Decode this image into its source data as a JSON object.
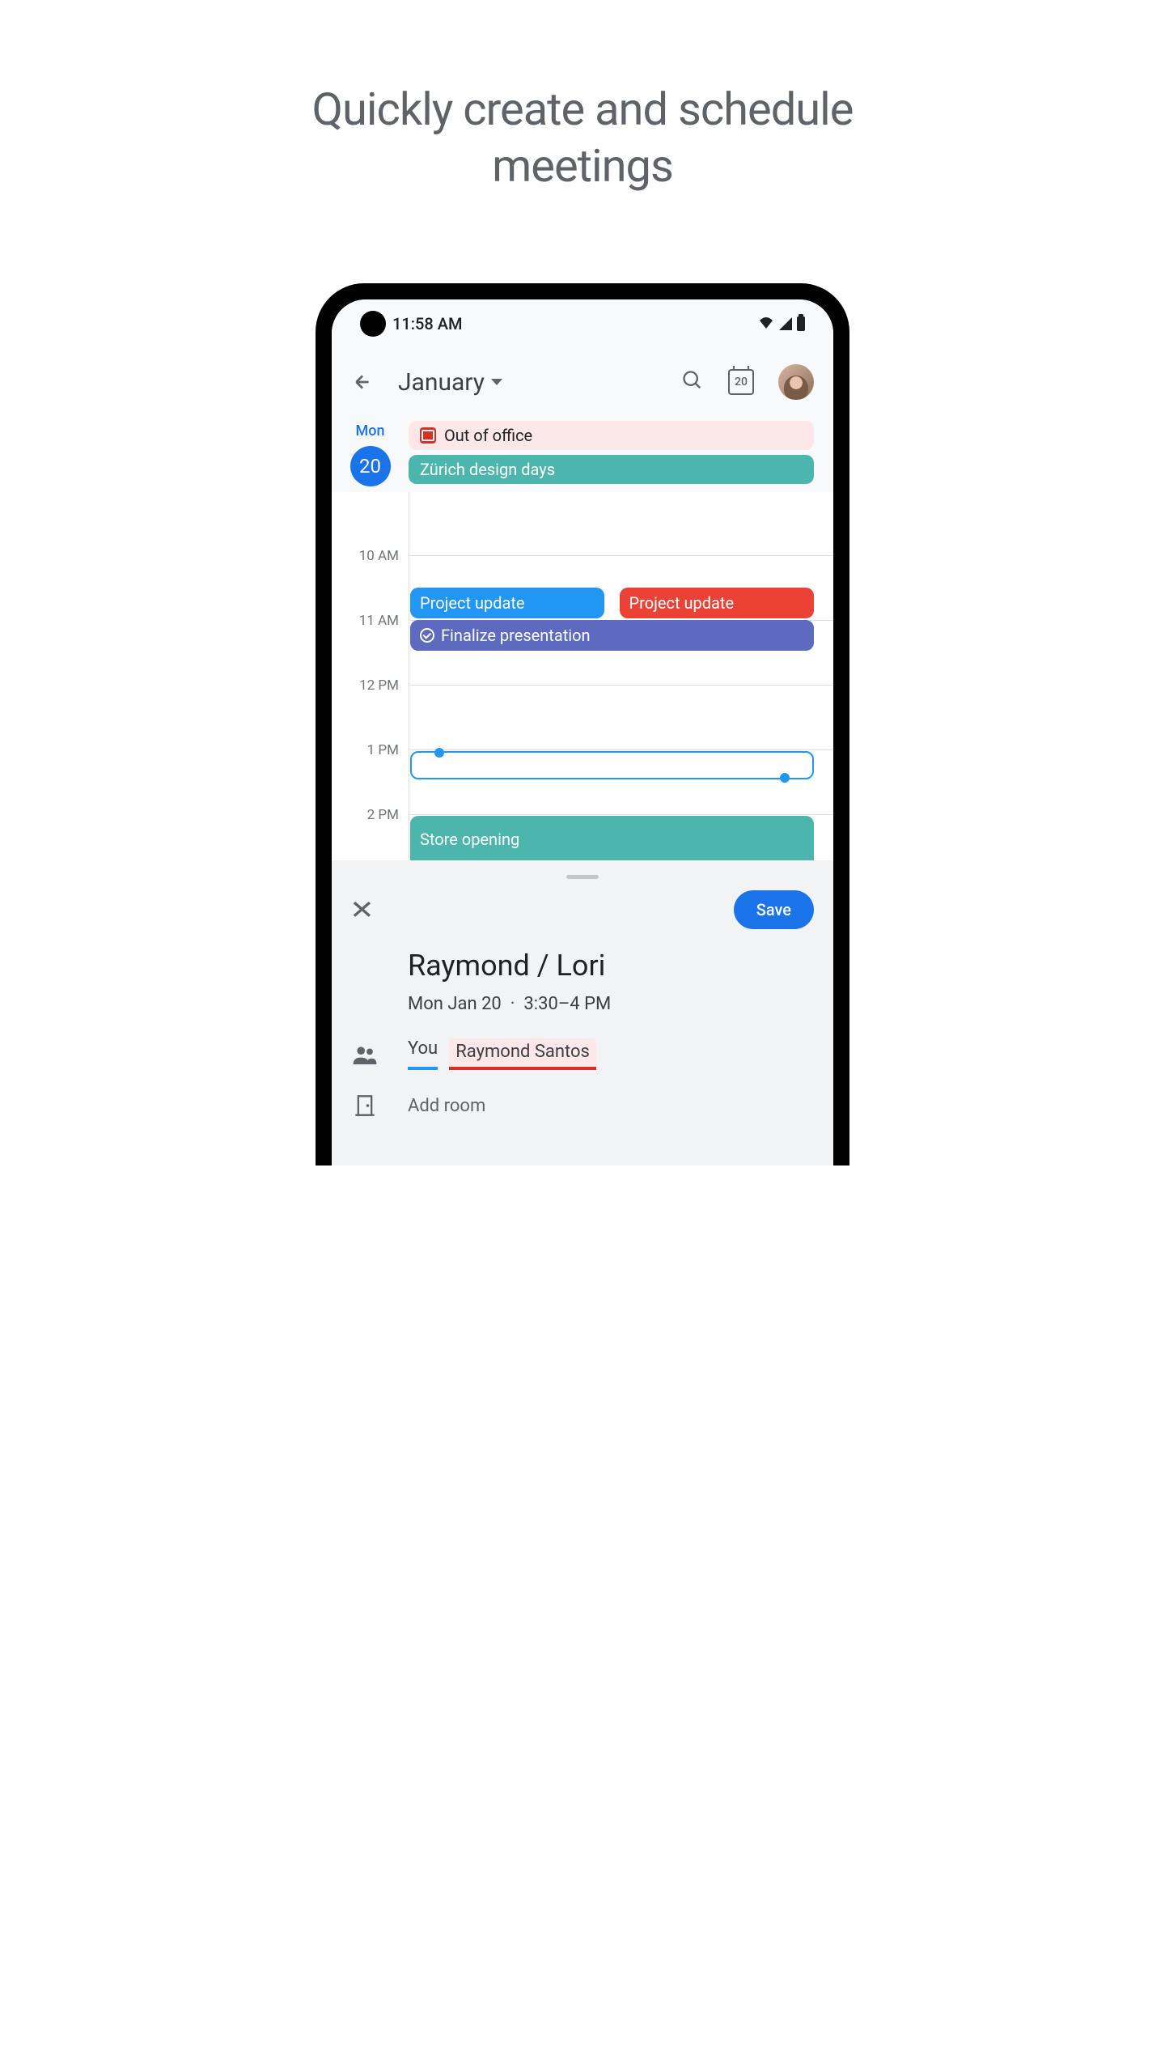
{
  "marketing": {
    "headline": "Quickly create and schedule meetings"
  },
  "statusBar": {
    "time": "11:58 AM"
  },
  "header": {
    "month": "January",
    "todayDate": "20"
  },
  "day": {
    "label": "Mon",
    "number": "20"
  },
  "alldayEvents": [
    {
      "label": "Out of office",
      "type": "ooo"
    },
    {
      "label": "Zürich design days",
      "type": "green"
    }
  ],
  "timeSlots": [
    "",
    "10 AM",
    "11 AM",
    "12 PM",
    "1 PM",
    "2 PM"
  ],
  "timedEvents": {
    "projectUpdate1": "Project update",
    "projectUpdate2": "Project update",
    "finalize": "Finalize presentation",
    "storeOpening": "Store opening"
  },
  "sheet": {
    "saveLabel": "Save",
    "title": "Raymond / Lori",
    "date": "Mon Jan 20",
    "separator": "·",
    "time": "3:30–4 PM",
    "chipYou": "You",
    "chipRaymond": "Raymond Santos",
    "addRoom": "Add room"
  }
}
